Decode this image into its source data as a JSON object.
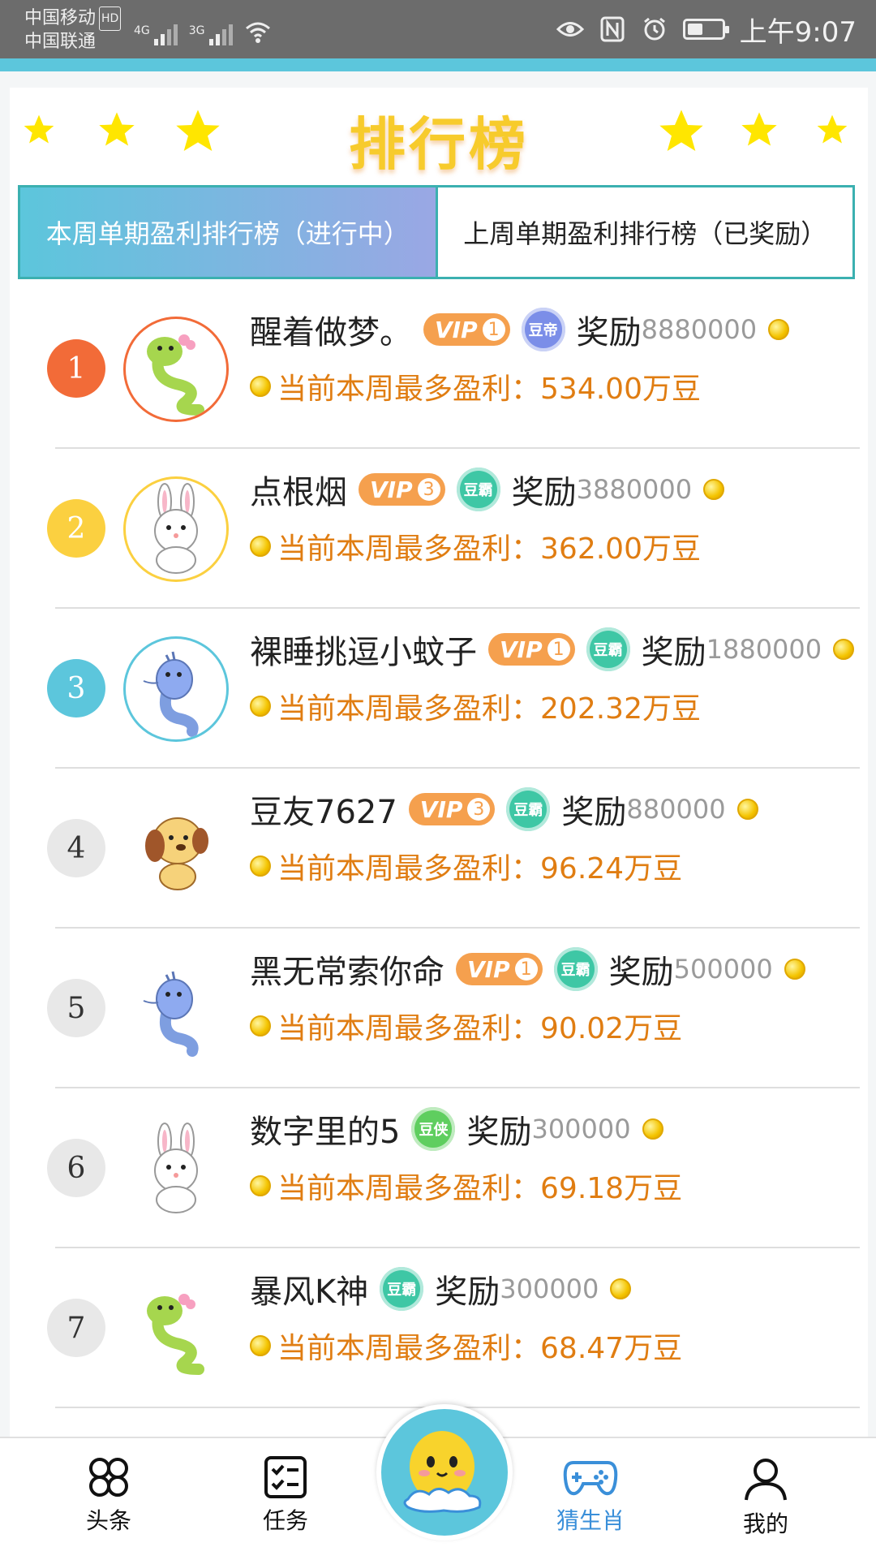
{
  "status_bar": {
    "carrier1": "中国移动",
    "hd": "HD",
    "carrier2": "中国联通",
    "net1": "4G",
    "net2": "3G",
    "time": "上午9:07"
  },
  "header": {
    "title": "排行榜"
  },
  "tabs": [
    {
      "label": "本周单期盈利排行榜（进行中）",
      "active": true
    },
    {
      "label": "上周单期盈利排行榜（已奖励）",
      "active": false
    }
  ],
  "profit_prefix": "当前本周最多盈利：",
  "reward_label": "奖励",
  "entries": [
    {
      "rank": "1",
      "name": "醒着做梦。",
      "vip": "1",
      "badge": "豆帝",
      "reward": "8880000",
      "profit": "534.00万豆"
    },
    {
      "rank": "2",
      "name": "点根烟",
      "vip": "3",
      "badge": "豆霸",
      "reward": "3880000",
      "profit": "362.00万豆"
    },
    {
      "rank": "3",
      "name": "裸睡挑逗小蚊子",
      "vip": "1",
      "badge": "豆霸",
      "reward": "1880000",
      "profit": "202.32万豆"
    },
    {
      "rank": "4",
      "name": "豆友7627",
      "vip": "3",
      "badge": "豆霸",
      "reward": "880000",
      "profit": "96.24万豆"
    },
    {
      "rank": "5",
      "name": "黑无常索你命",
      "vip": "1",
      "badge": "豆霸",
      "reward": "500000",
      "profit": "90.02万豆"
    },
    {
      "rank": "6",
      "name": "数字里的5",
      "vip": "",
      "badge": "豆侠",
      "reward": "300000",
      "profit": "69.18万豆"
    },
    {
      "rank": "7",
      "name": "暴风K神",
      "vip": "",
      "badge": "豆霸",
      "reward": "300000",
      "profit": "68.47万豆"
    }
  ],
  "colors": {
    "rank1": "#f26b38",
    "rank2": "#fbd040",
    "rank3": "#5cc6dc",
    "profit": "#e07d12",
    "accent": "#5cc6dc",
    "badge_emperor": "#7b8ee8",
    "badge_overlord": "#3ec7a5",
    "badge_hero": "#5fce5f"
  },
  "avatars": [
    "snake-avatar",
    "rabbit-avatar",
    "dragon-avatar",
    "dog-avatar",
    "dragon-avatar",
    "rabbit-avatar",
    "snake-avatar"
  ],
  "nav": {
    "headlines": "头条",
    "tasks": "任务",
    "guess_zodiac": "猜生肖",
    "mine": "我的"
  },
  "vip_text": "VIP"
}
